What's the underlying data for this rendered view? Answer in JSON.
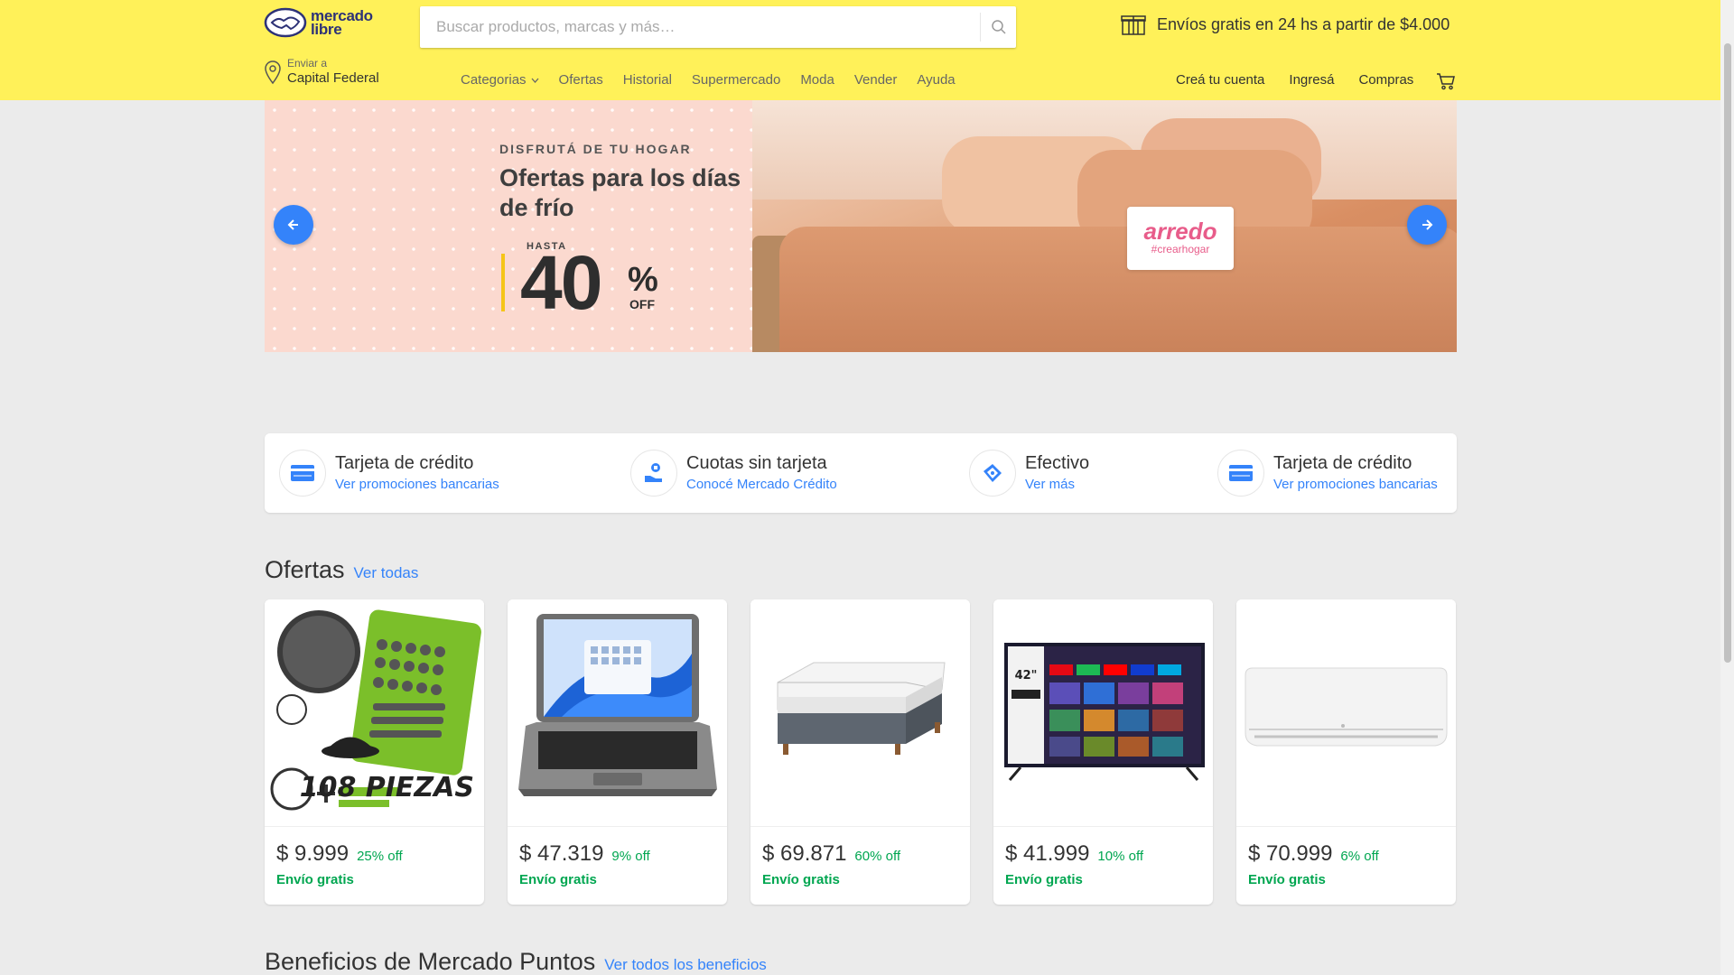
{
  "header": {
    "logo": {
      "line1": "mercado",
      "line2": "libre"
    },
    "search_placeholder": "Buscar productos, marcas y más…",
    "shipping_promo": "Envíos gratis en 24 hs a partir de $4.000",
    "location": {
      "label": "Enviar a",
      "value": "Capital Federal"
    },
    "nav": [
      "Categorias",
      "Ofertas",
      "Historial",
      "Supermercado",
      "Moda",
      "Vender",
      "Ayuda"
    ],
    "user_nav": [
      "Creá tu cuenta",
      "Ingresá",
      "Compras"
    ]
  },
  "banner": {
    "kicker": "DISFRUTÁ DE TU HOGAR",
    "headline": "Ofertas para los días de frío",
    "hasta": "HASTA",
    "percent": "40",
    "percent_sign": "%",
    "off": "OFF",
    "brand": "arredo",
    "brand_tag": "#crearhogar"
  },
  "payments": [
    {
      "title": "Tarjeta de crédito",
      "link": "Ver promociones bancarias",
      "icon": "credit-card-icon"
    },
    {
      "title": "Cuotas sin tarjeta",
      "link": "Conocé Mercado Crédito",
      "icon": "installments-icon"
    },
    {
      "title": "Efectivo",
      "link": "Ver más",
      "icon": "cash-icon"
    },
    {
      "title": "Tarjeta de crédito",
      "link": "Ver promociones bancarias",
      "icon": "credit-card-icon"
    }
  ],
  "offers": {
    "title": "Ofertas",
    "see_all": "Ver todas",
    "items": [
      {
        "price": "$ 9.999",
        "discount": "25% off",
        "shipping": "Envío gratis",
        "image": "tool-set",
        "image_text": "108 PIEZAS"
      },
      {
        "price": "$ 47.319",
        "discount": "9% off",
        "shipping": "Envío gratis",
        "image": "laptop"
      },
      {
        "price": "$ 69.871",
        "discount": "60% off",
        "shipping": "Envío gratis",
        "image": "mattress"
      },
      {
        "price": "$ 41.999",
        "discount": "10% off",
        "shipping": "Envío gratis",
        "image": "smart-tv",
        "image_text": "42\""
      },
      {
        "price": "$ 70.999",
        "discount": "6% off",
        "shipping": "Envío gratis",
        "image": "air-conditioner"
      }
    ]
  },
  "benefits": {
    "title": "Beneficios de Mercado Puntos",
    "see_all": "Ver todos los beneficios"
  },
  "colors": {
    "header_bg": "#fff159",
    "link": "#3483fa",
    "success": "#00a650",
    "page_bg": "#ebebeb"
  }
}
